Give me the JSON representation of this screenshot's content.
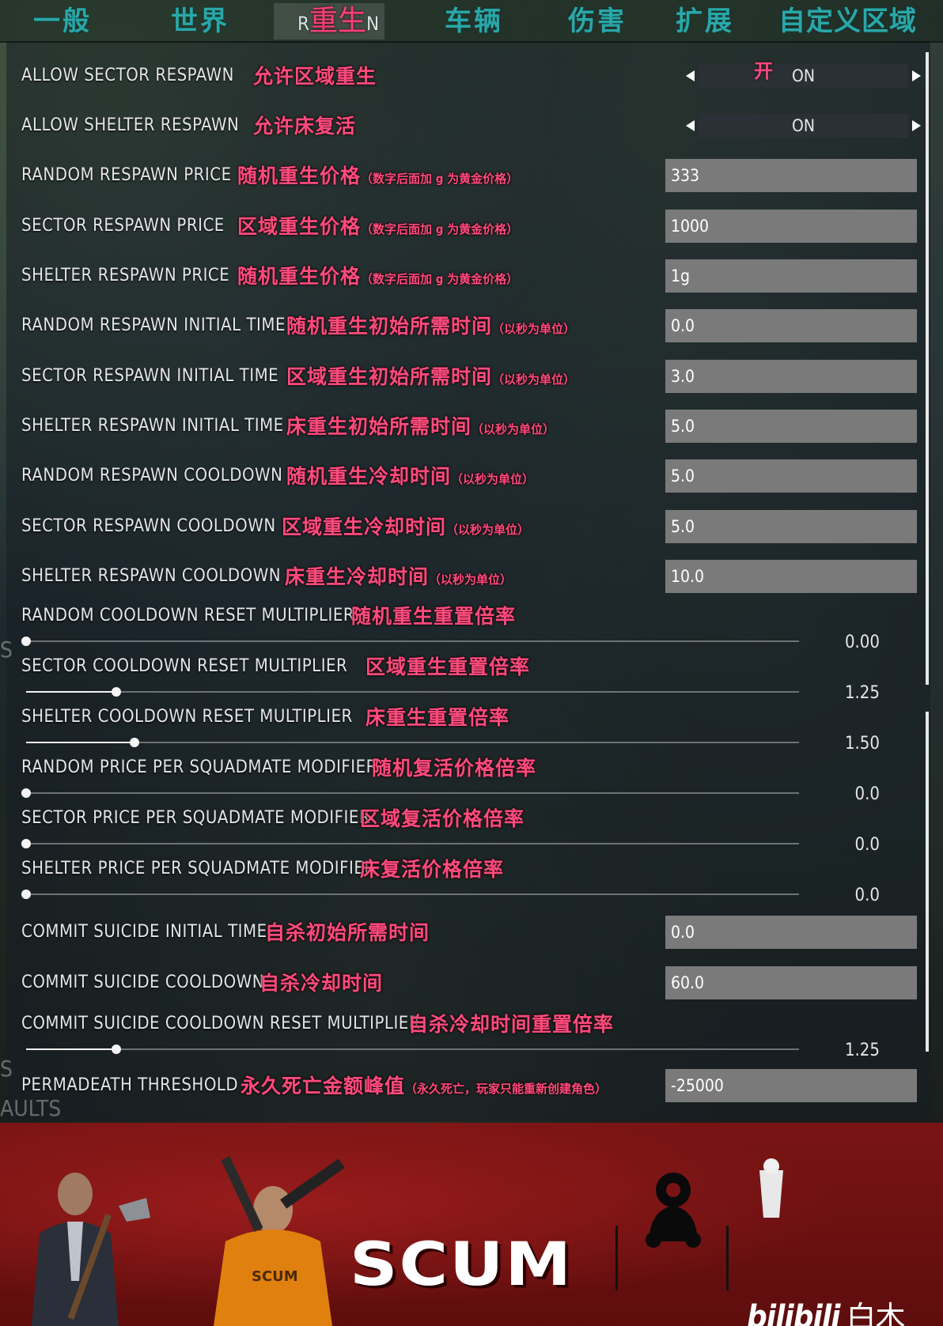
{
  "tabs": [
    {
      "label": "一般",
      "active": false
    },
    {
      "label": "世界",
      "active": false
    },
    {
      "label": "R",
      "annotation": "重生",
      "suffix": "N",
      "active": true
    },
    {
      "label": "车辆",
      "active": false
    },
    {
      "label": "伤害",
      "active": false
    },
    {
      "label": "扩展",
      "active": false
    },
    {
      "label": "自定义区域",
      "active": false
    }
  ],
  "rows": [
    {
      "label": "ALLOW SECTOR RESPAWN",
      "annotation": "允许区域重生",
      "type": "select",
      "value": "ON",
      "value_annotation": "开"
    },
    {
      "label": "ALLOW SHELTER RESPAWN",
      "annotation": "允许床复活",
      "type": "select",
      "value": "ON"
    },
    {
      "label": "RANDOM RESPAWN PRICE",
      "annotation": "随机重生价格",
      "note": "（数字后面加 g 为黄金价格）",
      "type": "input",
      "value": "333"
    },
    {
      "label": "SECTOR RESPAWN PRICE",
      "annotation": "区域重生价格",
      "note": "（数字后面加 g 为黄金价格）",
      "type": "input",
      "value": "1000"
    },
    {
      "label": "SHELTER RESPAWN PRICE",
      "annotation": "随机重生价格",
      "note": "（数字后面加 g 为黄金价格）",
      "type": "input",
      "value": "1g"
    },
    {
      "label": "RANDOM RESPAWN INITIAL TIME",
      "annotation": "随机重生初始所需时间",
      "note": "（以秒为单位）",
      "type": "input",
      "value": "0.0"
    },
    {
      "label": "SECTOR RESPAWN INITIAL TIME",
      "annotation": "区域重生初始所需时间",
      "note": "（以秒为单位）",
      "type": "input",
      "value": "3.0"
    },
    {
      "label": "SHELTER RESPAWN INITIAL TIME",
      "annotation": "床重生初始所需时间",
      "note": "（以秒为单位）",
      "type": "input",
      "value": "5.0"
    },
    {
      "label": "RANDOM RESPAWN COOLDOWN",
      "annotation": "随机重生冷却时间",
      "note": "（以秒为单位）",
      "type": "input",
      "value": "5.0"
    },
    {
      "label": "SECTOR RESPAWN COOLDOWN",
      "annotation": "区域重生冷却时间",
      "note": "（以秒为单位）",
      "type": "input",
      "value": "5.0"
    },
    {
      "label": "SHELTER RESPAWN COOLDOWN",
      "annotation": "床重生冷却时间",
      "note": "（以秒为单位）",
      "type": "input",
      "value": "10.0"
    },
    {
      "label": "RANDOM COOLDOWN RESET MULTIPLIER",
      "annotation": "随机重生重置倍率",
      "type": "slider",
      "value": "0.00",
      "fraction": 0.0
    },
    {
      "label": "SECTOR COOLDOWN RESET MULTIPLIER",
      "annotation": "区域重生重置倍率",
      "type": "slider",
      "value": "1.25",
      "fraction": 0.117
    },
    {
      "label": "SHELTER COOLDOWN RESET MULTIPLIER",
      "annotation": "床重生重置倍率",
      "type": "slider",
      "value": "1.50",
      "fraction": 0.14
    },
    {
      "label": "RANDOM PRICE PER SQUADMATE MODIFIER",
      "annotation": "随机复活价格倍率",
      "type": "slider",
      "value": "0.0",
      "fraction": 0.0
    },
    {
      "label": "SECTOR PRICE PER SQUADMATE MODIFIER",
      "annotation": "区域复活价格倍率",
      "type": "slider",
      "value": "0.0",
      "fraction": 0.0
    },
    {
      "label": "SHELTER PRICE PER SQUADMATE MODIFIER",
      "annotation": "床复活价格倍率",
      "type": "slider",
      "value": "0.0",
      "fraction": 0.0
    },
    {
      "label": "COMMIT SUICIDE INITIAL TIME",
      "annotation": "自杀初始所需时间",
      "type": "input",
      "value": "0.0"
    },
    {
      "label": "COMMIT SUICIDE COOLDOWN",
      "annotation": "自杀冷却时间",
      "type": "input",
      "value": "60.0"
    },
    {
      "label": "COMMIT SUICIDE COOLDOWN RESET MULTIPLIER",
      "annotation": "自杀冷却时间重置倍率",
      "type": "slider",
      "value": "1.25",
      "fraction": 0.117
    },
    {
      "label": "PERMADEATH THRESHOLD",
      "annotation": "永久死亡金额峰值",
      "note": "（永久死亡，玩家只能重新创建角色）",
      "type": "input",
      "value": "-25000"
    }
  ],
  "ghost_texts": [
    "S",
    "S",
    "AULTS"
  ],
  "footer": {
    "logo": "SCUM",
    "brand": "bilibili",
    "uploader": "白木Ilym"
  },
  "colors": {
    "tab": "#2aa7a8",
    "annotation": "#ff4b7d",
    "input_bg": "#7a7a7a",
    "footer": "#7a1414"
  }
}
